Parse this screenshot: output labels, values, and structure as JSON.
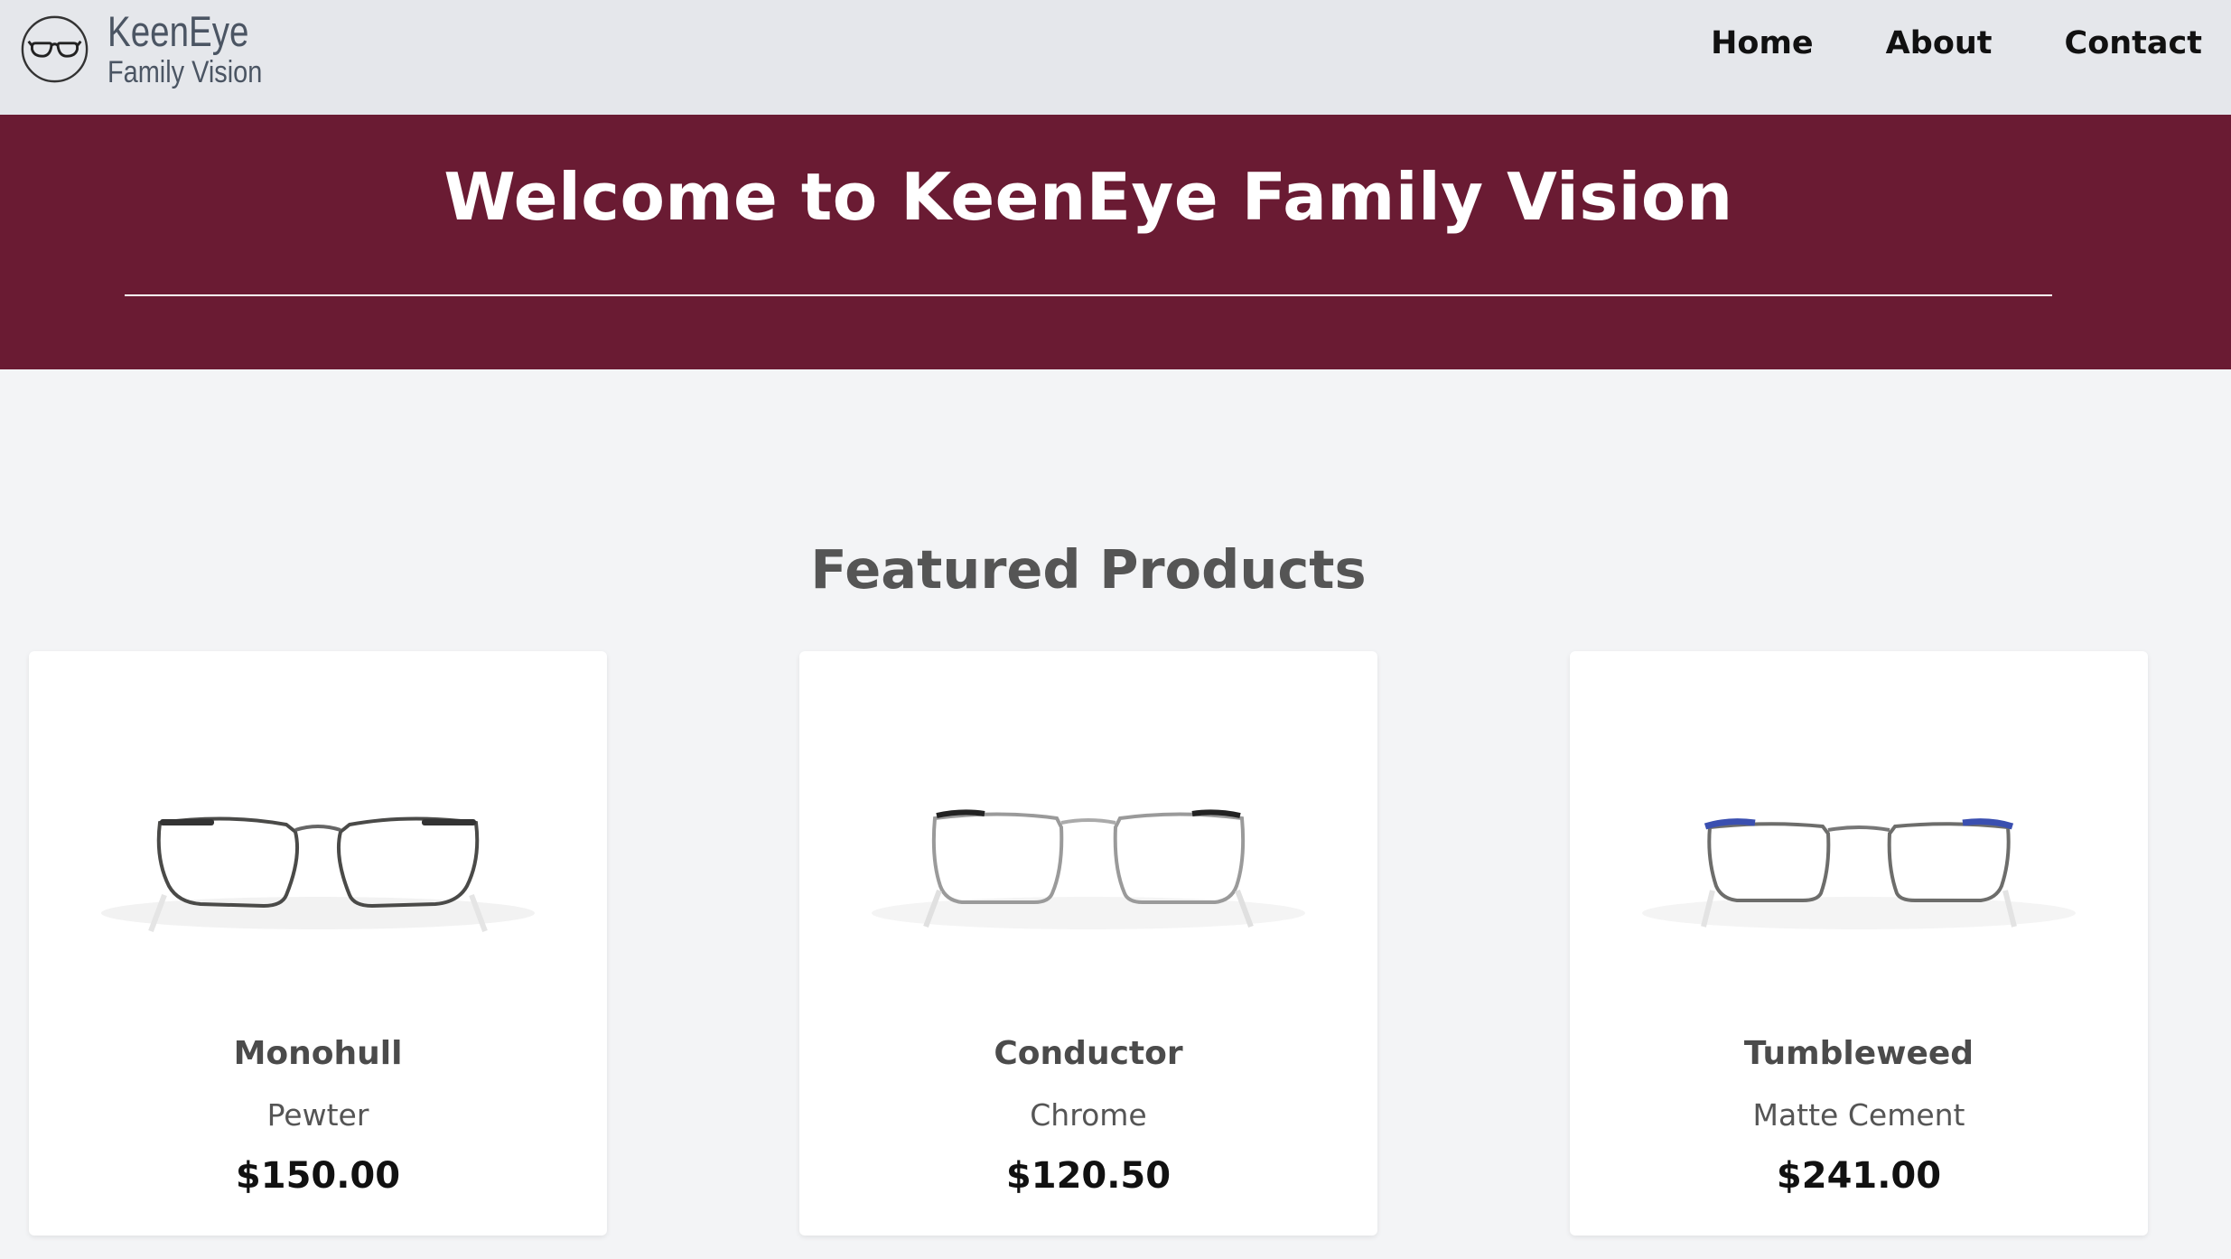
{
  "header": {
    "logo_line1": "KeenEye",
    "logo_line2": "Family Vision",
    "logo_icon": "glasses-icon",
    "nav": [
      {
        "label": "Home"
      },
      {
        "label": "About"
      },
      {
        "label": "Contact"
      }
    ]
  },
  "hero": {
    "title": "Welcome to KeenEye Family Vision",
    "background_color": "#6a1b33"
  },
  "featured": {
    "title": "Featured Products",
    "products": [
      {
        "name": "Monohull",
        "color": "Pewter",
        "price": "$150.00",
        "image_icon": "eyeglasses-image"
      },
      {
        "name": "Conductor",
        "color": "Chrome",
        "price": "$120.50",
        "image_icon": "eyeglasses-image"
      },
      {
        "name": "Tumbleweed",
        "color": "Matte Cement",
        "price": "$241.00",
        "image_icon": "eyeglasses-image"
      }
    ]
  }
}
